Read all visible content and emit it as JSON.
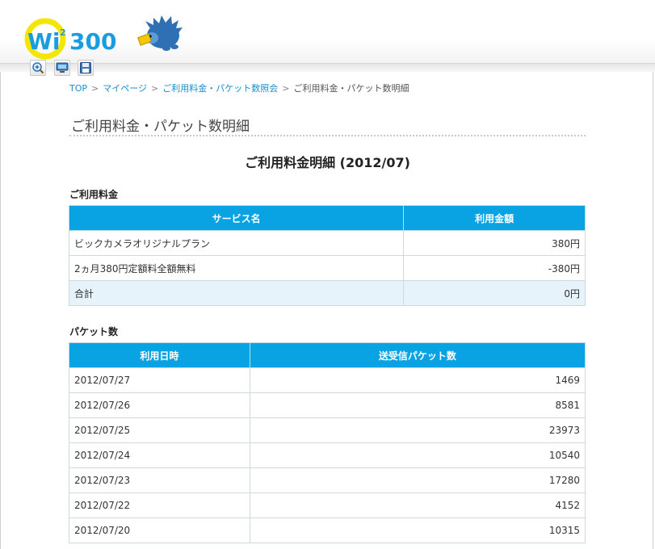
{
  "logo": {
    "text": "Wi2 300"
  },
  "toolbar": {
    "icons": [
      "zoom-in-icon",
      "monitor-icon",
      "save-icon"
    ]
  },
  "breadcrumb": {
    "items": [
      "TOP",
      "マイページ",
      "ご利用料金・パケット数照会"
    ],
    "current": "ご利用料金・パケット数明細",
    "separator": ">"
  },
  "page": {
    "title": "ご利用料金・パケット数明細",
    "section_title": "ご利用料金明細 (2012/07)"
  },
  "fees": {
    "heading": "ご利用料金",
    "columns": [
      "サービス名",
      "利用金額"
    ],
    "rows": [
      {
        "name": "ビックカメラオリジナルプラン",
        "amount": "380円"
      },
      {
        "name": "2ヵ月380円定額料全額無料",
        "amount": "-380円"
      }
    ],
    "total": {
      "label": "合計",
      "amount": "0円"
    }
  },
  "packets": {
    "heading": "パケット数",
    "columns": [
      "利用日時",
      "送受信パケット数"
    ],
    "rows": [
      {
        "date": "2012/07/27",
        "count": "1469"
      },
      {
        "date": "2012/07/26",
        "count": "8581"
      },
      {
        "date": "2012/07/25",
        "count": "23973"
      },
      {
        "date": "2012/07/24",
        "count": "10540"
      },
      {
        "date": "2012/07/23",
        "count": "17280"
      },
      {
        "date": "2012/07/22",
        "count": "4152"
      },
      {
        "date": "2012/07/20",
        "count": "10315"
      }
    ]
  },
  "colors": {
    "accent": "#09a3e3",
    "link": "#1a8fc9",
    "total_row": "#e6f3fb"
  }
}
